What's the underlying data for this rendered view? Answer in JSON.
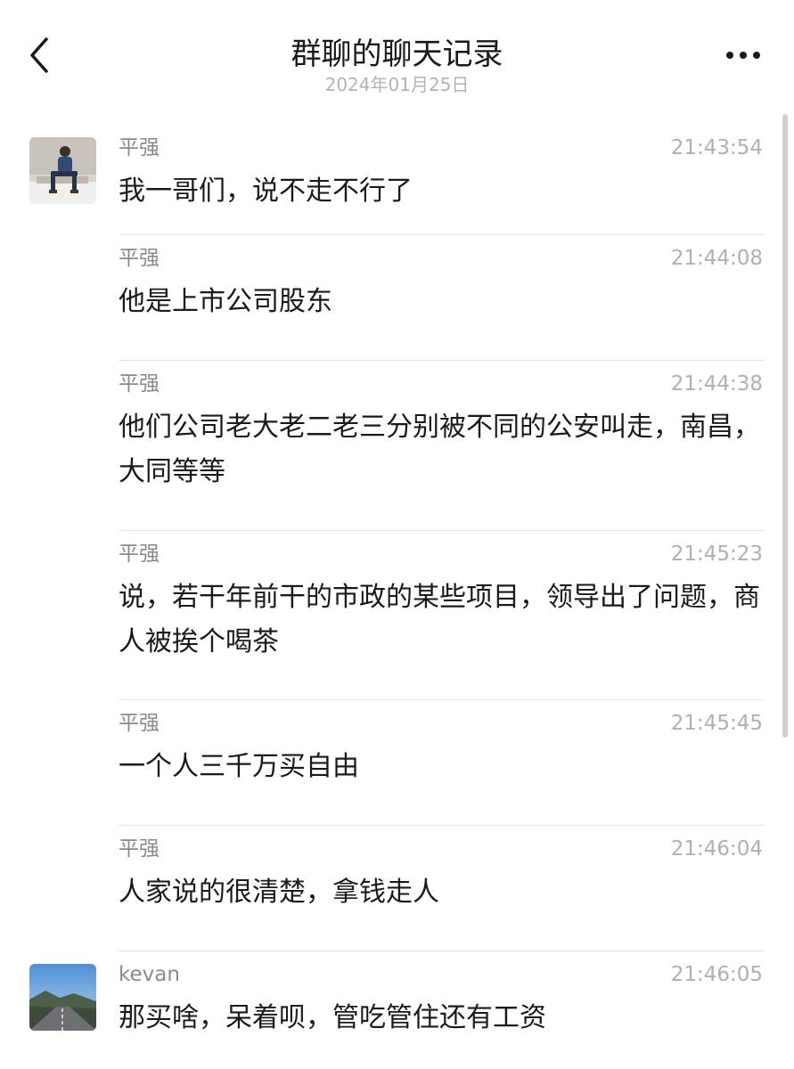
{
  "header": {
    "title": "群聊的聊天记录",
    "date": "2024年01月25日",
    "back_icon": "chevron-left-icon",
    "more_icon": "more-horizontal-icon"
  },
  "messages": [
    {
      "sender": "平强",
      "time": "21:43:54",
      "text": "我一哥们，说不走不行了",
      "avatar": "person-sitting-photo"
    },
    {
      "sender": "平强",
      "time": "21:44:08",
      "text": "他是上市公司股东"
    },
    {
      "sender": "平强",
      "time": "21:44:38",
      "text": "他们公司老大老二老三分别被不同的公安叫走，南昌，大同等等"
    },
    {
      "sender": "平强",
      "time": "21:45:23",
      "text": "说，若干年前干的市政的某些项目，领导出了问题，商人被挨个喝茶"
    },
    {
      "sender": "平强",
      "time": "21:45:45",
      "text": "一个人三千万买自由"
    },
    {
      "sender": "平强",
      "time": "21:46:04",
      "text": "人家说的很清楚，拿钱走人"
    },
    {
      "sender": "kevan",
      "time": "21:46:05",
      "text": "那买啥，呆着呗，管吃管住还有工资",
      "avatar": "road-landscape-photo"
    }
  ]
}
